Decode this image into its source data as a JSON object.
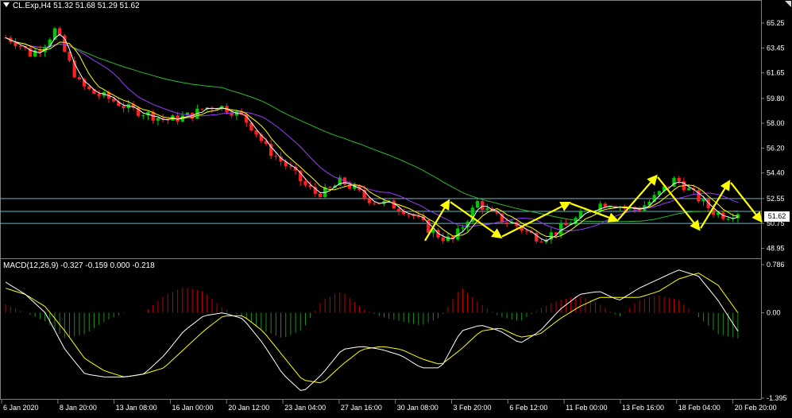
{
  "window": {
    "symbol_title": "CL.Exp,H4  51.32 51.68 51.29 51.62",
    "current_price": "51.62"
  },
  "macd": {
    "title": "MACD(12,26,9) -0.327 -0.159 0.000 -0.218",
    "axis_labels": [
      "0.786",
      "0.00",
      "-1.395"
    ]
  },
  "colors": {
    "background": "#000000",
    "bull_candle": "#00c800",
    "bear_candle": "#ff2020",
    "ma_fast": "#ffffff",
    "ma_mid": "#ffff00",
    "ma_slow": "#9a3bff",
    "ma_long": "#2eb82e",
    "level_line": "#5fb7c9",
    "arrows": "#ffff00",
    "macd_line": "#ffffff",
    "signal_line": "#ffff00",
    "hist_up": "#c00000",
    "hist_down": "#1e8c1e"
  },
  "chart_data": [
    {
      "type": "candlestick",
      "title": "CL.Exp,H4",
      "y_ticks": [
        "65.25",
        "63.45",
        "61.65",
        "59.80",
        "58.00",
        "56.20",
        "54.40",
        "52.55",
        "50.75",
        "48.95"
      ],
      "ylim": [
        48.4,
        66.0
      ],
      "x_ticks": [
        "6 Jan 2020",
        "8 Jan 20:00",
        "13 Jan 08:00",
        "16 Jan 00:00",
        "20 Jan 12:00",
        "23 Jan 04:00",
        "27 Jan 16:00",
        "30 Jan 08:00",
        "3 Feb 20:00",
        "6 Feb 12:00",
        "11 Feb 00:00",
        "13 Feb 16:00",
        "18 Feb 04:00",
        "20 Feb 20:00"
      ],
      "price_path": [
        64.2,
        63.8,
        63.0,
        63.6,
        64.8,
        62.6,
        60.8,
        60.2,
        59.9,
        59.5,
        59.0,
        58.8,
        58.5,
        58.2,
        58.4,
        58.6,
        59.1,
        59.3,
        59.0,
        58.5,
        57.6,
        56.2,
        55.4,
        54.6,
        53.6,
        52.9,
        53.1,
        53.8,
        53.3,
        52.6,
        52.3,
        52.1,
        51.8,
        51.2,
        50.4,
        49.8,
        49.5,
        50.8,
        52.3,
        51.5,
        51.0,
        50.7,
        50.1,
        49.7,
        50.0,
        50.5,
        51.1,
        51.7,
        52.2,
        52.2,
        51.8,
        51.8,
        52.4,
        53.2,
        54.0,
        53.2,
        52.4,
        51.6,
        51.3,
        51.6
      ],
      "horizontal_levels": [
        52.55,
        51.62,
        50.75
      ],
      "zigzag_arrows": [
        [
          49.5,
          52.3
        ],
        [
          52.3,
          49.8
        ],
        [
          49.8,
          52.2
        ],
        [
          52.2,
          51.0
        ],
        [
          51.0,
          54.1
        ],
        [
          54.1,
          50.4
        ],
        [
          50.4,
          53.7
        ],
        [
          53.7,
          51.0
        ]
      ]
    },
    {
      "type": "macd",
      "title": "MACD(12,26,9)",
      "params": [
        12,
        26,
        9
      ],
      "values": {
        "macd": -0.327,
        "signal": -0.159,
        "histogram_a": 0.0,
        "histogram_b": -0.218
      },
      "ylim": [
        -1.395,
        0.786
      ],
      "macd_line": [
        0.5,
        0.3,
        0.0,
        -0.6,
        -1.0,
        -1.05,
        -1.05,
        -1.0,
        -0.7,
        -0.3,
        -0.05,
        0.0,
        -0.1,
        -0.5,
        -1.0,
        -1.3,
        -1.0,
        -0.6,
        -0.55,
        -0.6,
        -0.7,
        -0.9,
        -0.9,
        -0.3,
        -0.2,
        -0.3,
        -0.5,
        -0.3,
        0.05,
        0.3,
        0.35,
        0.2,
        0.4,
        0.55,
        0.7,
        0.6,
        0.2,
        -0.3
      ],
      "signal_line": [
        0.4,
        0.3,
        0.1,
        -0.3,
        -0.75,
        -0.95,
        -1.05,
        -1.0,
        -0.9,
        -0.6,
        -0.3,
        -0.05,
        -0.05,
        -0.3,
        -0.7,
        -1.1,
        -1.15,
        -0.85,
        -0.6,
        -0.55,
        -0.6,
        -0.75,
        -0.85,
        -0.6,
        -0.3,
        -0.25,
        -0.4,
        -0.35,
        -0.1,
        0.1,
        0.25,
        0.25,
        0.25,
        0.35,
        0.55,
        0.65,
        0.45,
        0.0
      ]
    }
  ]
}
